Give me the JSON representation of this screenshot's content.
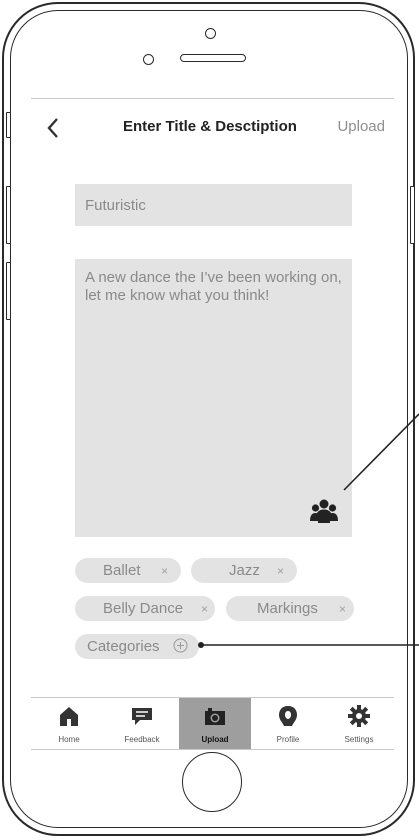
{
  "nav": {
    "back_icon": "chevron-left-icon",
    "title": "Enter Title & Desctiption",
    "action_label": "Upload"
  },
  "form": {
    "title_value": "Futuristic",
    "description_value": "A new dance the I’ve been working on, let me know what you think!",
    "audience_icon": "group-users-icon"
  },
  "tags": [
    {
      "label": "Ballet",
      "remove": "×"
    },
    {
      "label": "Jazz",
      "remove": "×"
    },
    {
      "label": "Belly Dance",
      "remove": "×"
    },
    {
      "label": "Markings",
      "remove": "×"
    }
  ],
  "categories_label": "Categories",
  "tabbar": {
    "items": [
      {
        "label": "Home",
        "icon": "home-icon"
      },
      {
        "label": "Feedback",
        "icon": "feedback-icon"
      },
      {
        "label": "Upload",
        "icon": "camera-icon",
        "active": true
      },
      {
        "label": "Profile",
        "icon": "profile-icon"
      },
      {
        "label": "Settings",
        "icon": "gear-icon"
      }
    ]
  },
  "colors": {
    "field_bg": "#e3e3e3",
    "placeholder_text": "#8a8a8a",
    "active_tab_bg": "#9e9e9e"
  }
}
